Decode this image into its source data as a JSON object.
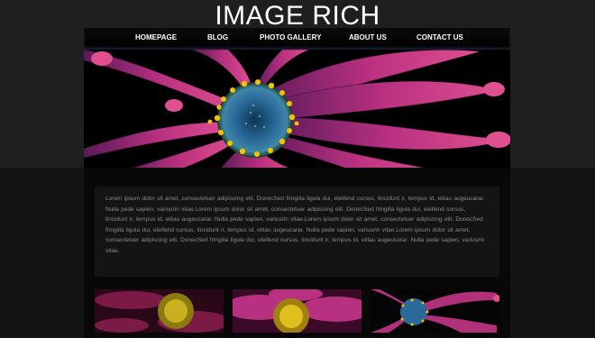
{
  "site": {
    "title": "IMAGE RICH"
  },
  "nav": {
    "items": [
      {
        "label": "HOMEPAGE"
      },
      {
        "label": "BLOG"
      },
      {
        "label": "PHOTO GALLERY"
      },
      {
        "label": "ABOUT US"
      },
      {
        "label": "CONTACT US"
      }
    ]
  },
  "hero": {
    "image": "daisy-flower-closeup"
  },
  "content": {
    "body": "Lorem ipsum dolor sit amet, consectetuer adipiscing elit. DonecSed fringilla ligula dui, eleifend cursus, tincidunt ir, tempus id, elitau augeucarar. Nulla pede sapien, variusrin vitae.Lorem ipsum dolor sit amet, consectetuer adipiscing elit. DonecSed fringilla ligula dui, eleifend cursus, tincidunt ir, tempus id, elitau augeucarar. Nulla pede sapien, variusrin vitae.Lorem ipsum dolor sit amet, consectetuer adipiscing elit. DonecSed fringilla ligula dui, eleifend cursus, tincidunt ir, tempus id, elitau augeucarar. Nulla pede sapien, variusrin vitae.Lorem ipsum dolor sit amet, consectetuer adipiscing elit. DonecSed fringilla ligula dui, eleifend cursus, tincidunt ir, tempus id, elitau augeucarar. Nulla pede sapien, variusrin vitae."
  },
  "gallery": {
    "thumbnails": [
      {
        "image": "flower-thumbnail-1"
      },
      {
        "image": "flower-thumbnail-2"
      },
      {
        "image": "flower-thumbnail-3"
      }
    ]
  },
  "colors": {
    "background": "#1f1f1f",
    "container": "#080808",
    "text": "#8a8a8a",
    "petal": "#c8307e",
    "center": "#2a6a9a",
    "pollen": "#f0c400"
  }
}
